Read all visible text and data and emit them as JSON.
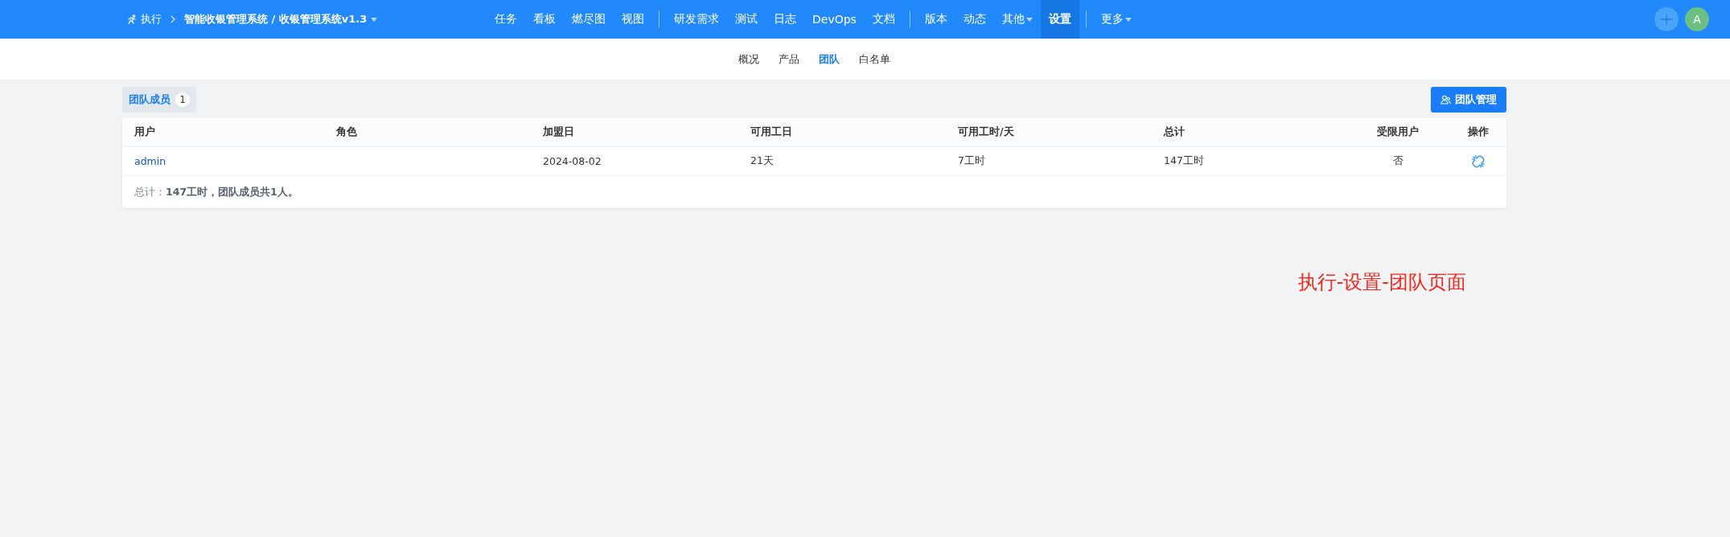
{
  "topbar": {
    "module": "执行",
    "breadcrumb": "智能收银管理系统 / 收银管理系统v1.3",
    "nav_groups": [
      [
        {
          "label": "任务",
          "selected": false,
          "dropdown": false
        },
        {
          "label": "看板",
          "selected": false,
          "dropdown": false
        },
        {
          "label": "燃尽图",
          "selected": false,
          "dropdown": false
        },
        {
          "label": "视图",
          "selected": false,
          "dropdown": false
        }
      ],
      [
        {
          "label": "研发需求",
          "selected": false,
          "dropdown": false
        },
        {
          "label": "测试",
          "selected": false,
          "dropdown": false
        },
        {
          "label": "日志",
          "selected": false,
          "dropdown": false
        },
        {
          "label": "DevOps",
          "selected": false,
          "dropdown": false
        },
        {
          "label": "文档",
          "selected": false,
          "dropdown": false
        }
      ],
      [
        {
          "label": "版本",
          "selected": false,
          "dropdown": false
        },
        {
          "label": "动态",
          "selected": false,
          "dropdown": false
        },
        {
          "label": "其他",
          "selected": false,
          "dropdown": true
        },
        {
          "label": "设置",
          "selected": true,
          "dropdown": false
        }
      ],
      [
        {
          "label": "更多",
          "selected": false,
          "dropdown": true
        }
      ]
    ],
    "avatar": "A"
  },
  "subnav": [
    {
      "label": "概况",
      "selected": false
    },
    {
      "label": "产品",
      "selected": false
    },
    {
      "label": "团队",
      "selected": true
    },
    {
      "label": "白名单",
      "selected": false
    }
  ],
  "members_tab": {
    "label": "团队成员",
    "count": "1"
  },
  "manage_button": "团队管理",
  "table": {
    "columns": [
      "用户",
      "角色",
      "加盟日",
      "可用工日",
      "可用工时/天",
      "总计",
      "受限用户",
      "操作"
    ],
    "rows": [
      {
        "user": "admin",
        "role": "",
        "join_date": "2024-08-02",
        "work_days": "21天",
        "hours_per_day": "7工时",
        "total": "147工时",
        "limited": "否"
      }
    ],
    "footer": "总计：**147工时，团队成员共1人。**"
  },
  "annotation": "执行-设置-团队页面"
}
